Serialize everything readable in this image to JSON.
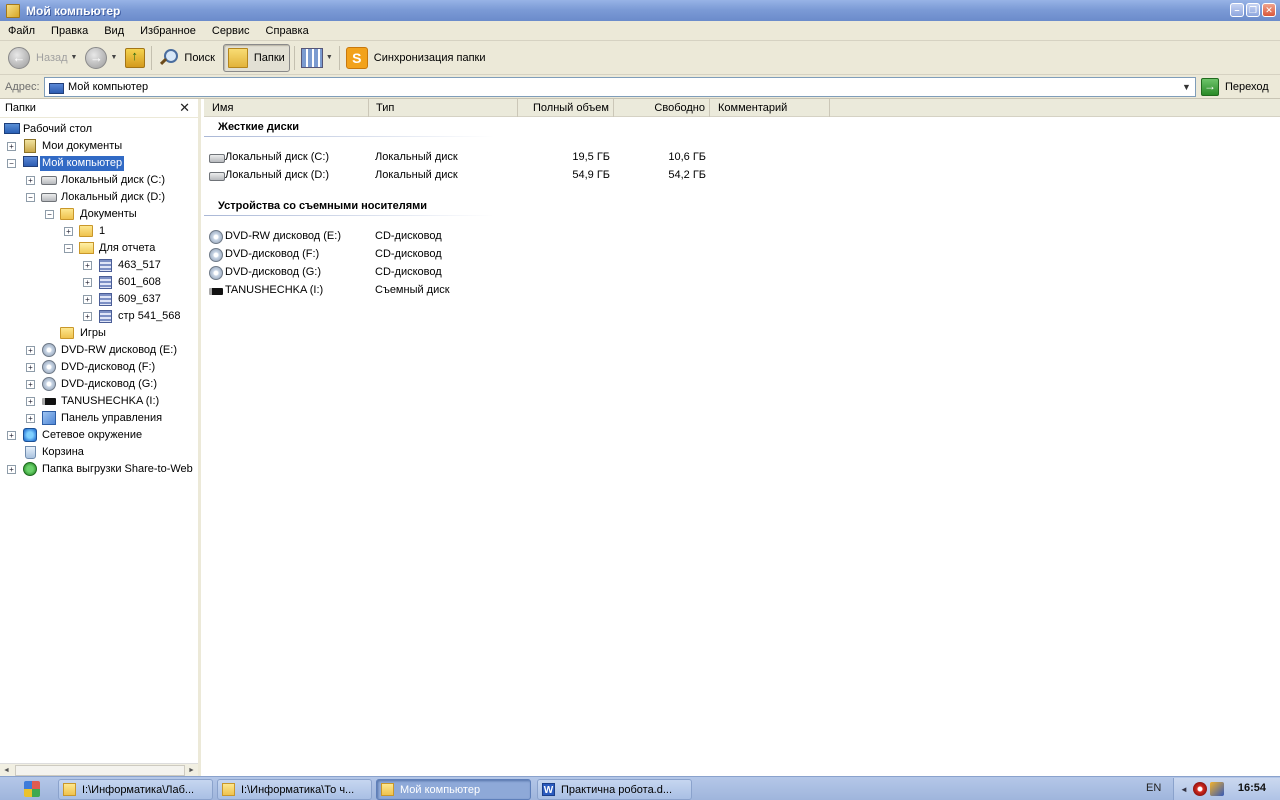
{
  "window": {
    "title": "Мой компьютер"
  },
  "menu": [
    "Файл",
    "Правка",
    "Вид",
    "Избранное",
    "Сервис",
    "Справка"
  ],
  "toolbar": {
    "back": "Назад",
    "search": "Поиск",
    "folders": "Папки",
    "sync": "Синхронизация папки"
  },
  "address": {
    "label": "Адрес:",
    "value": "Мой компьютер",
    "go": "Переход"
  },
  "leftpane": {
    "title": "Папки",
    "tree": [
      "Рабочий стол",
      "Мои документы",
      "Мой компьютер",
      "Локальный диск (C:)",
      "Локальный диск (D:)",
      "Документы",
      "1",
      "Для отчета",
      "463_517",
      "601_608",
      "609_637",
      "стр 541_568",
      "Игры",
      "DVD-RW дисковод (E:)",
      "DVD-дисковод (F:)",
      "DVD-дисковод (G:)",
      "TANUSHECHKA (I:)",
      "Панель управления",
      "Сетевое окружение",
      "Корзина",
      "Папка выгрузки Share-to-Web"
    ]
  },
  "columns": [
    "Имя",
    "Тип",
    "Полный объем",
    "Свободно",
    "Комментарий"
  ],
  "groups": {
    "hard": {
      "title": "Жесткие диски",
      "items": [
        {
          "name": "Локальный диск (C:)",
          "type": "Локальный диск",
          "total": "19,5 ГБ",
          "free": "10,6 ГБ"
        },
        {
          "name": "Локальный диск (D:)",
          "type": "Локальный диск",
          "total": "54,9 ГБ",
          "free": "54,2 ГБ"
        }
      ]
    },
    "removable": {
      "title": "Устройства со съемными носителями",
      "items": [
        {
          "name": "DVD-RW дисковод (E:)",
          "type": "CD-дисковод"
        },
        {
          "name": "DVD-дисковод (F:)",
          "type": "CD-дисковод"
        },
        {
          "name": "DVD-дисковод (G:)",
          "type": "CD-дисковод"
        },
        {
          "name": "TANUSHECHKA (I:)",
          "type": "Съемный диск"
        }
      ]
    }
  },
  "taskbar": {
    "buttons": [
      "I:\\Информатика\\Лаб...",
      "I:\\Информатика\\То ч...",
      "Мой компьютер",
      "Практична робота.d..."
    ],
    "lang": "EN",
    "clock": "16:54"
  }
}
